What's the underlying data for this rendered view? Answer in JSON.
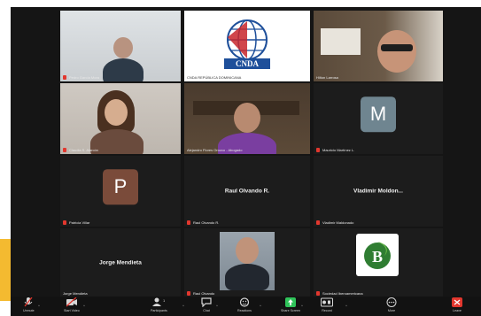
{
  "meeting": {
    "participants": [
      {
        "id": "p1",
        "name": "Pedro García Mora",
        "mic_muted": true,
        "type": "video"
      },
      {
        "id": "p2",
        "name": "CNDA REPÚBLICA DOMINICANA",
        "mic_muted": false,
        "type": "logo",
        "logo_text": "CNDA"
      },
      {
        "id": "p3",
        "name": "Hilton Larrosa",
        "mic_muted": false,
        "type": "video"
      },
      {
        "id": "p4",
        "name": "Claudia S. Alarcón",
        "mic_muted": true,
        "type": "video"
      },
      {
        "id": "p5",
        "name": "Alejandro Flores Orozco - Abogado",
        "mic_muted": false,
        "type": "video",
        "active_speaker": true
      },
      {
        "id": "p6",
        "name": "Mauricio Martínez L.",
        "mic_muted": true,
        "type": "avatar",
        "initial": "M",
        "avatar_color": "#6f8590"
      },
      {
        "id": "p7",
        "name": "Patricia Villar",
        "mic_muted": true,
        "type": "avatar",
        "initial": "P",
        "avatar_color": "#7a4b3a"
      },
      {
        "id": "p8",
        "name": "Raul Olvando R.",
        "mic_muted": true,
        "type": "name",
        "center_text": "Raul Olvando R."
      },
      {
        "id": "p9",
        "name": "Vladimir Maldonado",
        "mic_muted": true,
        "type": "name",
        "center_text": "Vladimir Moldon..."
      },
      {
        "id": "p10",
        "name": "Jorge Mendieta",
        "mic_muted": false,
        "type": "name",
        "center_text": "Jorge Mendieta"
      },
      {
        "id": "p11",
        "name": "Raul Olvando",
        "mic_muted": true,
        "type": "video"
      },
      {
        "id": "p12",
        "name": "Sociedad Iberoamericana",
        "mic_muted": true,
        "type": "logo",
        "logo_text": "B"
      }
    ]
  },
  "toolbar": {
    "mute": "Unmute",
    "video": "Start Video",
    "participants": "Participants",
    "participants_count": "14",
    "chat": "Chat",
    "reactions": "Reactions",
    "share": "Share Screen",
    "record": "Record",
    "more": "More",
    "leave": "Leave",
    "colors": {
      "accent": "#2fc35a",
      "muted": "#e2372e",
      "leave": "#e2372e"
    }
  }
}
